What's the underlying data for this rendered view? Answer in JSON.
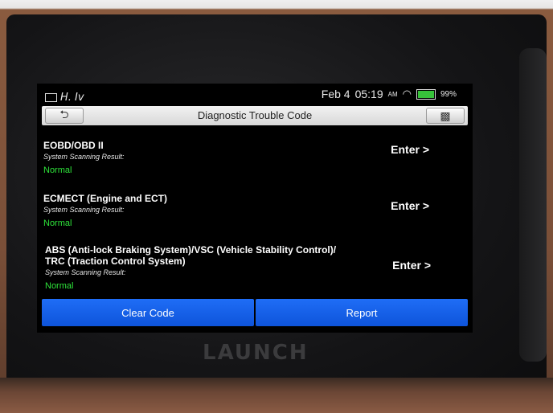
{
  "status": {
    "left_text": "H. Iv",
    "date": "Feb 4",
    "time": "05:19",
    "ampm": "AM",
    "battery_pct": "99%",
    "battery_color": "#37c23a"
  },
  "header": {
    "title": "Diagnostic Trouble Code",
    "back_icon": "back-arrow-icon",
    "exit_icon": "exit-icon"
  },
  "systems": [
    {
      "name": "EOBD/OBD II",
      "sub": "System Scanning Result:",
      "result": "Normal",
      "enter": "Enter >"
    },
    {
      "name": "ECMECT (Engine and ECT)",
      "sub": "System Scanning Result:",
      "result": "Normal",
      "enter": "Enter >"
    },
    {
      "name": "ABS (Anti-lock Braking System)/VSC (Vehicle Stability Control)/\nTRC (Traction Control System)",
      "sub": "System Scanning Result:",
      "result": "Normal",
      "enter": "Enter >"
    }
  ],
  "footer": {
    "clear_label": "Clear Code",
    "report_label": "Report",
    "accent": "#1f6df6"
  },
  "device": {
    "brand": "LAUNCH"
  }
}
